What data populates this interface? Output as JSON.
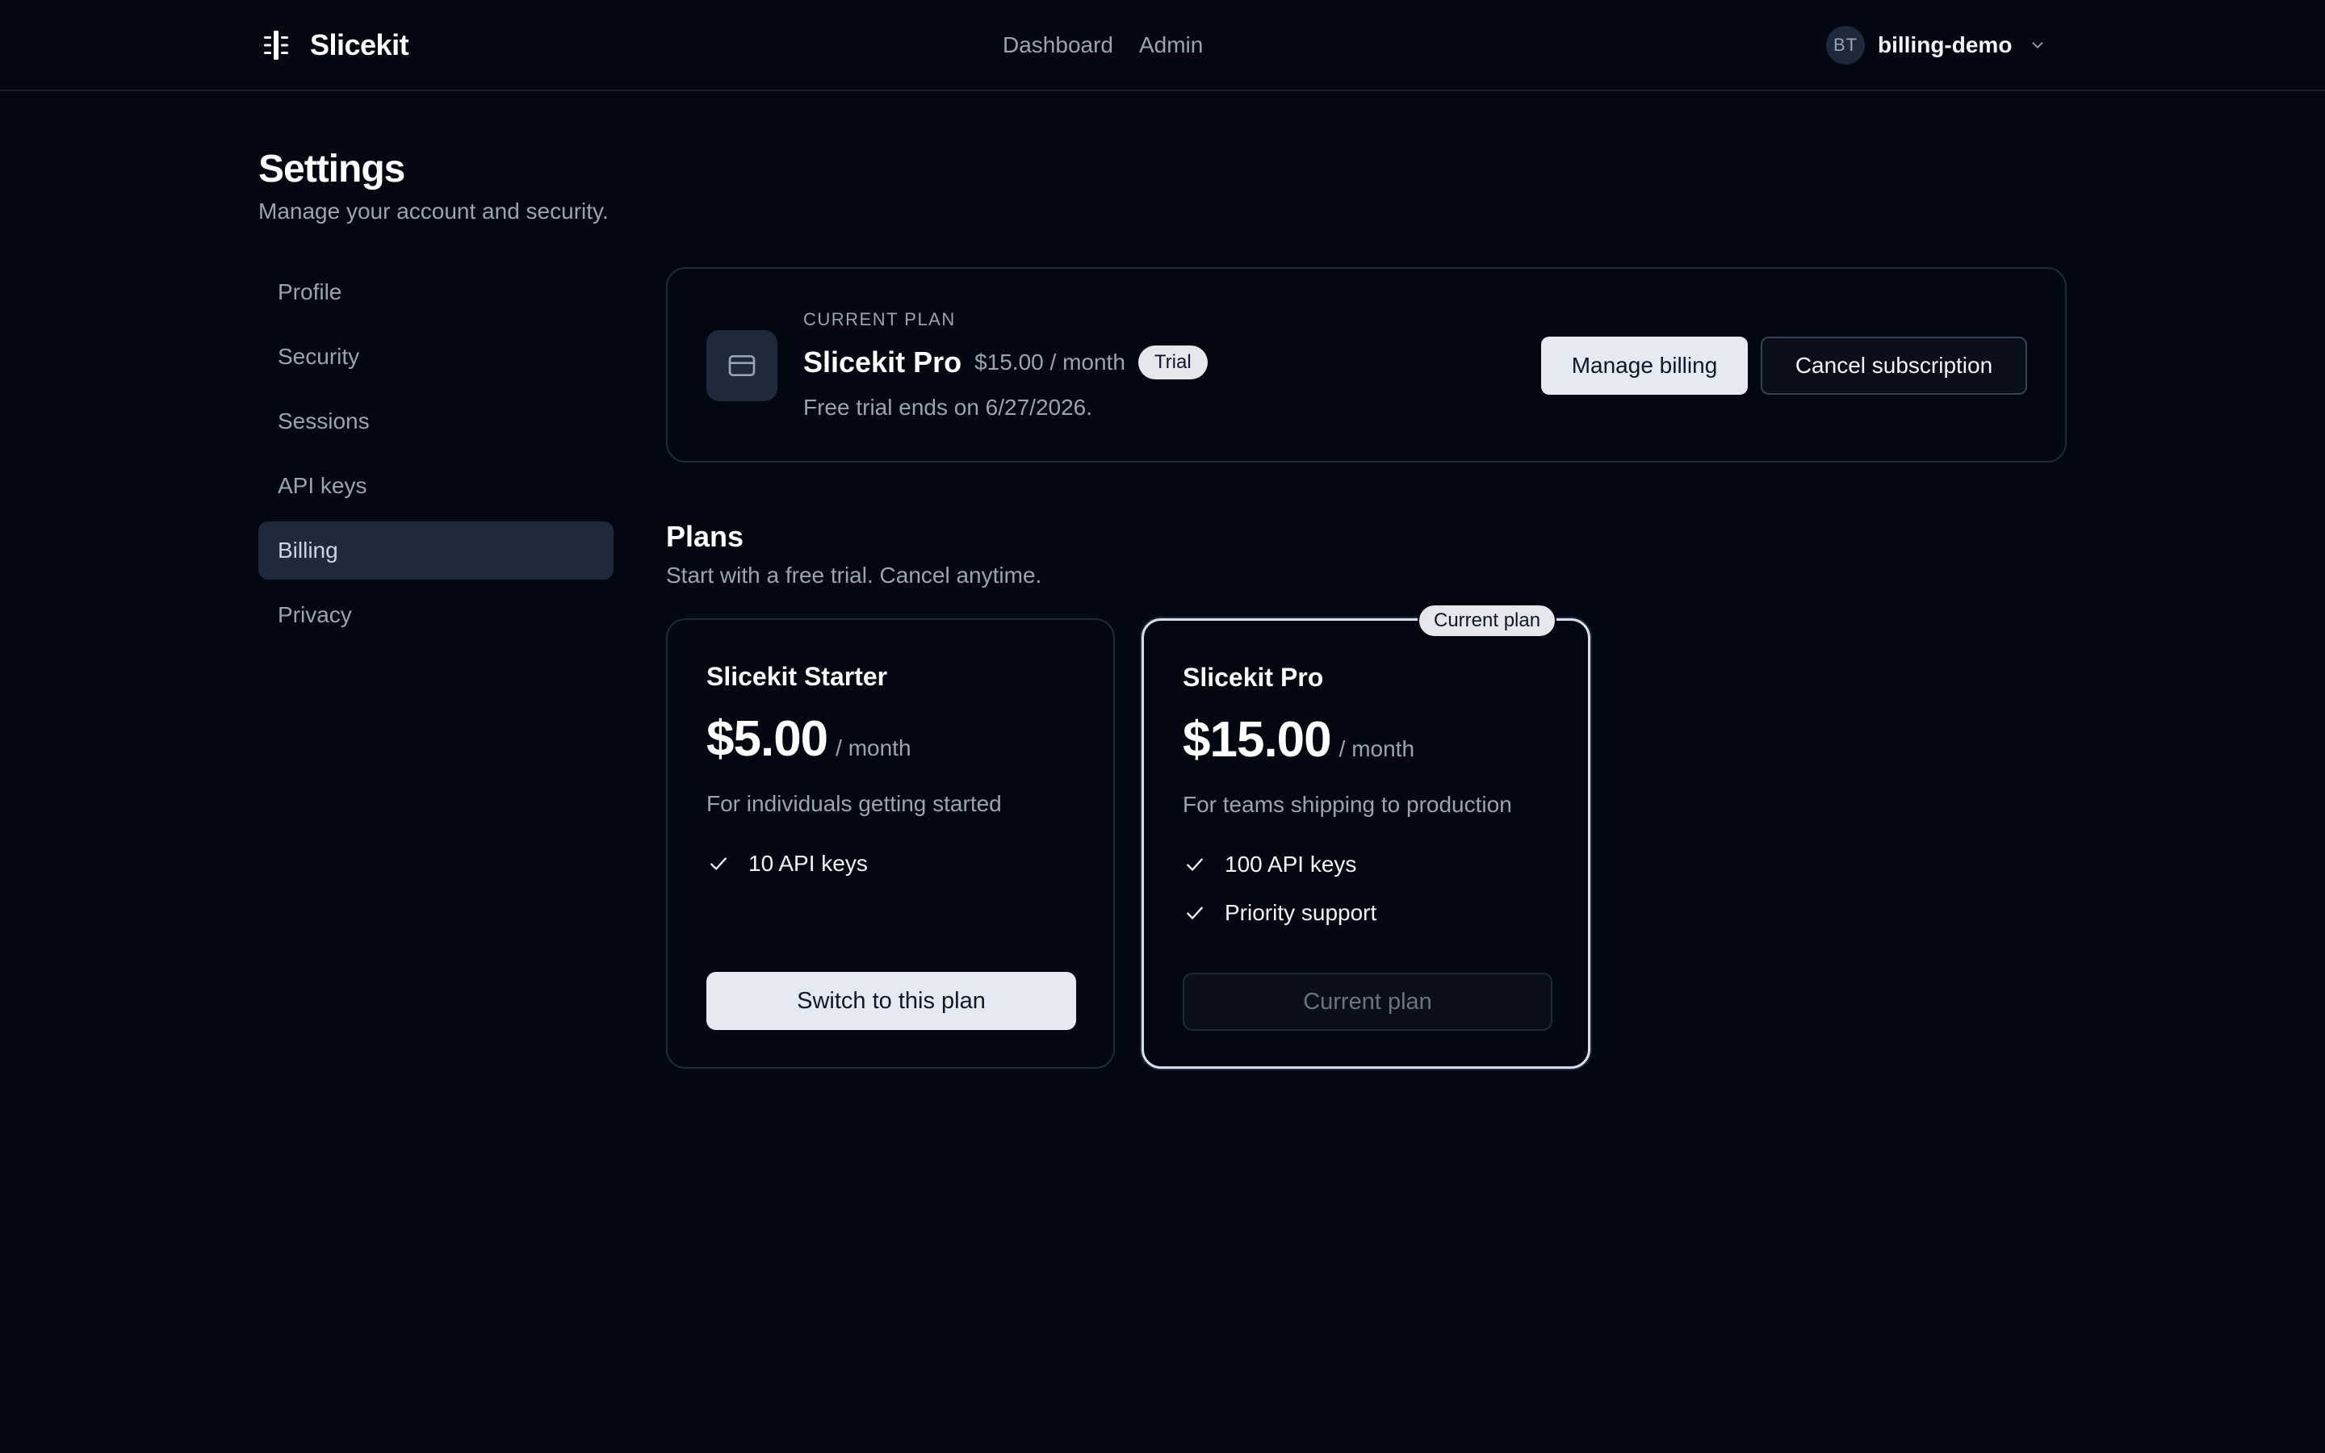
{
  "header": {
    "brand_name": "Slicekit",
    "nav": [
      {
        "label": "Dashboard"
      },
      {
        "label": "Admin"
      }
    ],
    "user": {
      "initials": "BT",
      "name": "billing-demo"
    }
  },
  "page": {
    "title": "Settings",
    "subtitle": "Manage your account and security."
  },
  "sidebar": {
    "items": [
      {
        "label": "Profile"
      },
      {
        "label": "Security"
      },
      {
        "label": "Sessions"
      },
      {
        "label": "API keys"
      },
      {
        "label": "Billing"
      },
      {
        "label": "Privacy"
      }
    ],
    "active": "Billing"
  },
  "current_plan": {
    "eyebrow": "CURRENT PLAN",
    "name": "Slicekit Pro",
    "price": "$15.00 / month",
    "badge": "Trial",
    "note": "Free trial ends on 6/27/2026.",
    "manage_label": "Manage billing",
    "cancel_label": "Cancel subscription"
  },
  "plans": {
    "title": "Plans",
    "subtitle": "Start with a free trial. Cancel anytime.",
    "current_badge": "Current plan",
    "cards": [
      {
        "name": "Slicekit Starter",
        "price": "$5.00",
        "period": "/ month",
        "description": "For individuals getting started",
        "features": [
          "10 API keys"
        ],
        "button": "Switch to this plan"
      },
      {
        "name": "Slicekit Pro",
        "price": "$15.00",
        "period": "/ month",
        "description": "For teams shipping to production",
        "features": [
          "100 API keys",
          "Priority support"
        ],
        "button": "Current plan"
      }
    ]
  },
  "icons": {
    "brand": "slice-logo-icon",
    "chevron": "chevron-down-icon",
    "plan": "credit-card-icon",
    "feature": "check-icon"
  },
  "colors": {
    "background": "#030712",
    "surface": "#1e293b",
    "border": "#1f2937",
    "muted_text": "#9ca3af",
    "primary_button": "#e5e9f2"
  }
}
